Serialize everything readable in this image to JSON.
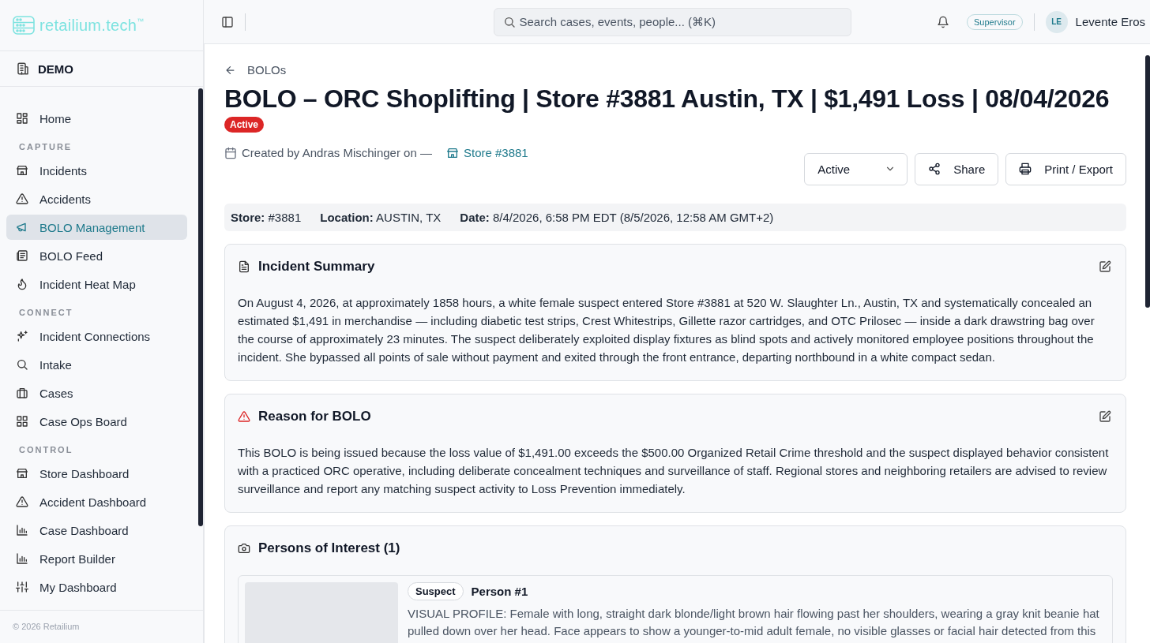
{
  "sidebar": {
    "logo": "retailium.tech",
    "trademark": "™",
    "org": "DEMO",
    "sections": [
      {
        "items": [
          {
            "label": "Home",
            "selected": false
          }
        ]
      },
      {
        "heading": "CAPTURE",
        "items": [
          {
            "label": "Incidents",
            "selected": false
          },
          {
            "label": "Accidents",
            "selected": false
          },
          {
            "label": "BOLO Management",
            "selected": true
          },
          {
            "label": "BOLO Feed",
            "selected": false
          },
          {
            "label": "Incident Heat Map",
            "selected": false
          }
        ]
      },
      {
        "heading": "CONNECT",
        "items": [
          {
            "label": "Incident Connections",
            "selected": false
          },
          {
            "label": "Intake",
            "selected": false
          },
          {
            "label": "Cases",
            "selected": false
          },
          {
            "label": "Case Ops Board",
            "selected": false
          }
        ]
      },
      {
        "heading": "CONTROL",
        "items": [
          {
            "label": "Store Dashboard",
            "selected": false
          },
          {
            "label": "Accident Dashboard",
            "selected": false
          },
          {
            "label": "Case Dashboard",
            "selected": false
          },
          {
            "label": "Report Builder",
            "selected": false
          },
          {
            "label": "My Dashboard",
            "selected": false
          }
        ]
      }
    ],
    "footer": "© 2026 Retailium"
  },
  "topbar": {
    "search": {
      "placeholder": "Search cases, events, people... (⌘K)"
    },
    "role": "Supervisor",
    "user": {
      "initials": "LE",
      "name": "Levente Eros"
    }
  },
  "page": {
    "back": "BOLOs",
    "title": "BOLO – ORC Shoplifting | Store #3881 Austin, TX | $1,491 Loss | 08/04/2026",
    "status": "Active",
    "created": "Created by Andras Mischinger on —",
    "store_link": "Store #3881",
    "status_select": "Active",
    "buttons": [
      "Share",
      "Print / Export"
    ],
    "facts": [
      {
        "label": "Store:",
        "value": "#3881"
      },
      {
        "label": "Location:",
        "value": "AUSTIN, TX"
      },
      {
        "label": "Date:",
        "value": "8/4/2026, 6:58 PM EDT (8/5/2026, 12:58 AM GMT+2)"
      }
    ],
    "sections": [
      {
        "kind": "summary",
        "title": "Incident Summary",
        "text": "On August 4, 2026, at approximately 1858 hours, a white female suspect entered Store #3881 at 520 W. Slaughter Ln., Austin, TX and systematically concealed an estimated $1,491 in merchandise — including diabetic test strips, Crest Whitestrips, Gillette razor cartridges, and OTC Prilosec — inside a dark drawstring bag over the course of approximately 23 minutes. The suspect deliberately exploited display fixtures as blind spots and actively monitored employee positions throughout the incident. She bypassed all points of sale without payment and exited through the front entrance, departing northbound in a white compact sedan."
      },
      {
        "kind": "reason",
        "title": "Reason for BOLO",
        "text": "This BOLO is being issued because the loss value of $1,491.00 exceeds the $500.00 Organized Retail Crime threshold and the suspect displayed behavior consistent with a practiced ORC operative, including deliberate concealment techniques and surveillance of staff. Regional stores and neighboring retailers are advised to review surveillance and report any matching suspect activity to Loss Prevention immediately."
      },
      {
        "kind": "persons",
        "title": "Persons of Interest (1)",
        "persons": [
          {
            "role": "Suspect",
            "name": "Person #1",
            "profile": "VISUAL PROFILE: Female with long, straight dark blonde/light brown hair flowing past her shoulders, wearing a gray knit beanie hat pulled down over her head. Face appears to show a younger-to-mid adult female, no visible glasses or facial hair detected from this"
          }
        ]
      }
    ]
  }
}
